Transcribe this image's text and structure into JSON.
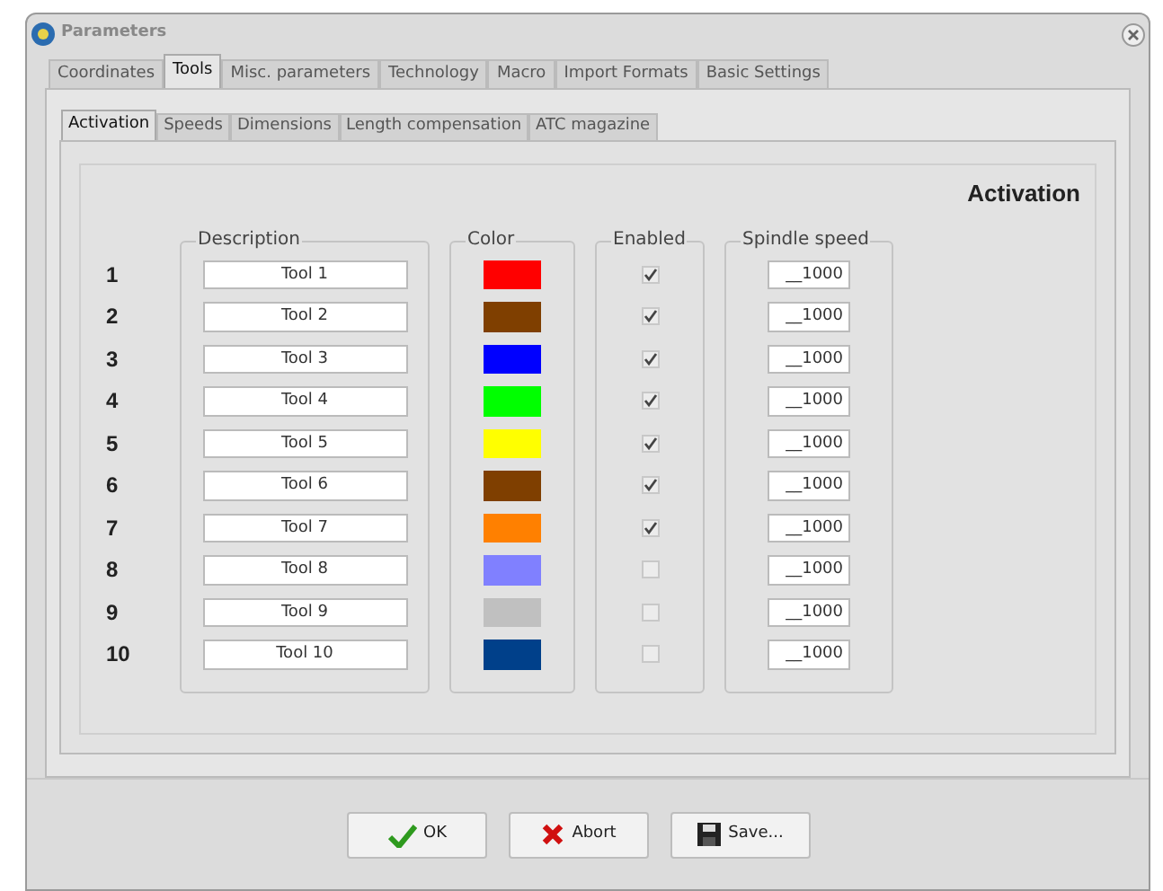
{
  "window": {
    "title": "Parameters"
  },
  "tabs": [
    {
      "label": "Coordinates",
      "selected": false
    },
    {
      "label": "Tools",
      "selected": true
    },
    {
      "label": "Misc. parameters",
      "selected": false
    },
    {
      "label": "Technology",
      "selected": false
    },
    {
      "label": "Macro",
      "selected": false
    },
    {
      "label": "Import Formats",
      "selected": false
    },
    {
      "label": "Basic Settings",
      "selected": false
    }
  ],
  "subtabs": [
    {
      "label": "Activation",
      "selected": true
    },
    {
      "label": "Speeds",
      "selected": false
    },
    {
      "label": "Dimensions",
      "selected": false
    },
    {
      "label": "Length compensation",
      "selected": false
    },
    {
      "label": "ATC magazine",
      "selected": false
    }
  ],
  "panel": {
    "heading": "Activation",
    "columns": [
      "Description",
      "Color",
      "Enabled",
      "Spindle speed"
    ],
    "tools": [
      {
        "number": "1",
        "description": "Tool 1",
        "color": "#ff0000",
        "enabled": true,
        "speed": "__1000"
      },
      {
        "number": "2",
        "description": "Tool 2",
        "color": "#7f3f00",
        "enabled": true,
        "speed": "__1000"
      },
      {
        "number": "3",
        "description": "Tool 3",
        "color": "#0000ff",
        "enabled": true,
        "speed": "__1000"
      },
      {
        "number": "4",
        "description": "Tool 4",
        "color": "#00ff00",
        "enabled": true,
        "speed": "__1000"
      },
      {
        "number": "5",
        "description": "Tool 5",
        "color": "#ffff00",
        "enabled": true,
        "speed": "__1000"
      },
      {
        "number": "6",
        "description": "Tool 6",
        "color": "#7f3f00",
        "enabled": true,
        "speed": "__1000"
      },
      {
        "number": "7",
        "description": "Tool 7",
        "color": "#ff8000",
        "enabled": true,
        "speed": "__1000"
      },
      {
        "number": "8",
        "description": "Tool 8",
        "color": "#8080ff",
        "enabled": false,
        "speed": "__1000"
      },
      {
        "number": "9",
        "description": "Tool 9",
        "color": "#c0c0c0",
        "enabled": false,
        "speed": "__1000"
      },
      {
        "number": "10",
        "description": "Tool 10",
        "color": "#00408a",
        "enabled": false,
        "speed": "__1000"
      }
    ]
  },
  "buttons": [
    {
      "kind": "ok",
      "label": "OK"
    },
    {
      "kind": "abort",
      "label": "Abort"
    },
    {
      "kind": "save",
      "label": "Save..."
    }
  ]
}
